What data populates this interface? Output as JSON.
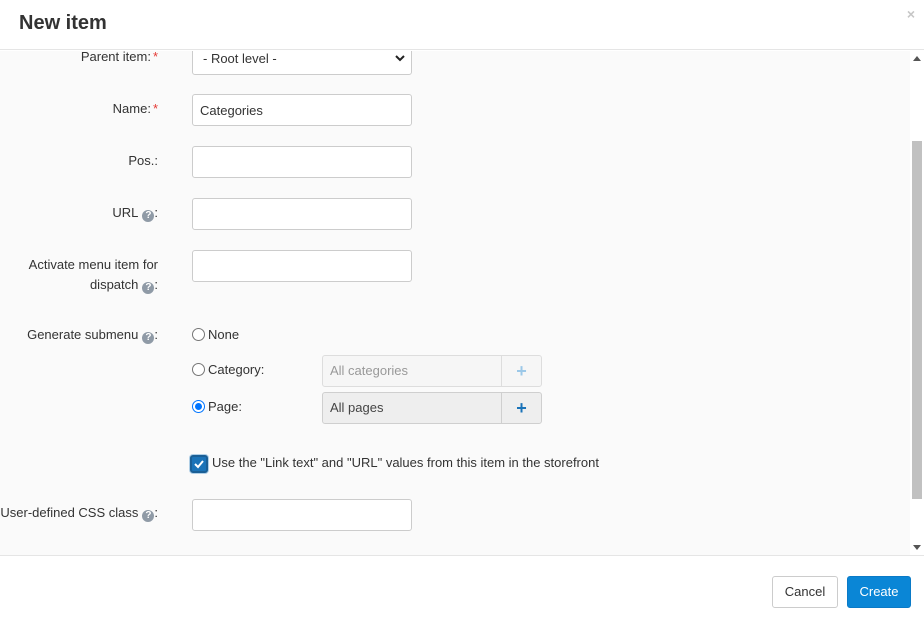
{
  "dialog": {
    "title": "New item",
    "close_glyph": "×"
  },
  "form": {
    "parent_item": {
      "label": "Parent item:",
      "required_mark": "*",
      "value": "- Root level -"
    },
    "name": {
      "label": "Name:",
      "required_mark": "*",
      "value": "Categories"
    },
    "pos": {
      "label": "Pos.:",
      "value": ""
    },
    "url": {
      "label": "URL",
      "suffix": ":",
      "value": ""
    },
    "dispatch": {
      "label_line1": "Activate menu item for",
      "label_line2": "dispatch",
      "suffix": ":",
      "value": ""
    },
    "generate_submenu": {
      "label": "Generate submenu",
      "suffix": ":",
      "options": [
        {
          "label": "None",
          "checked": false
        },
        {
          "label": "Category:",
          "checked": false,
          "picker_text": "All categories"
        },
        {
          "label": "Page:",
          "checked": true,
          "picker_text": "All pages"
        }
      ]
    },
    "use_values_checkbox": {
      "label": "Use the \"Link text\" and \"URL\" values from this item in the storefront",
      "checked": true
    },
    "css_class": {
      "label": "User-defined CSS class",
      "suffix": ":",
      "value": ""
    },
    "help_glyph": "?",
    "add_glyph": "+"
  },
  "footer": {
    "cancel_label": "Cancel",
    "create_label": "Create"
  },
  "colors": {
    "primary": "#0a86d6",
    "required": "#e53935",
    "help_icon": "#8f9aa6"
  }
}
